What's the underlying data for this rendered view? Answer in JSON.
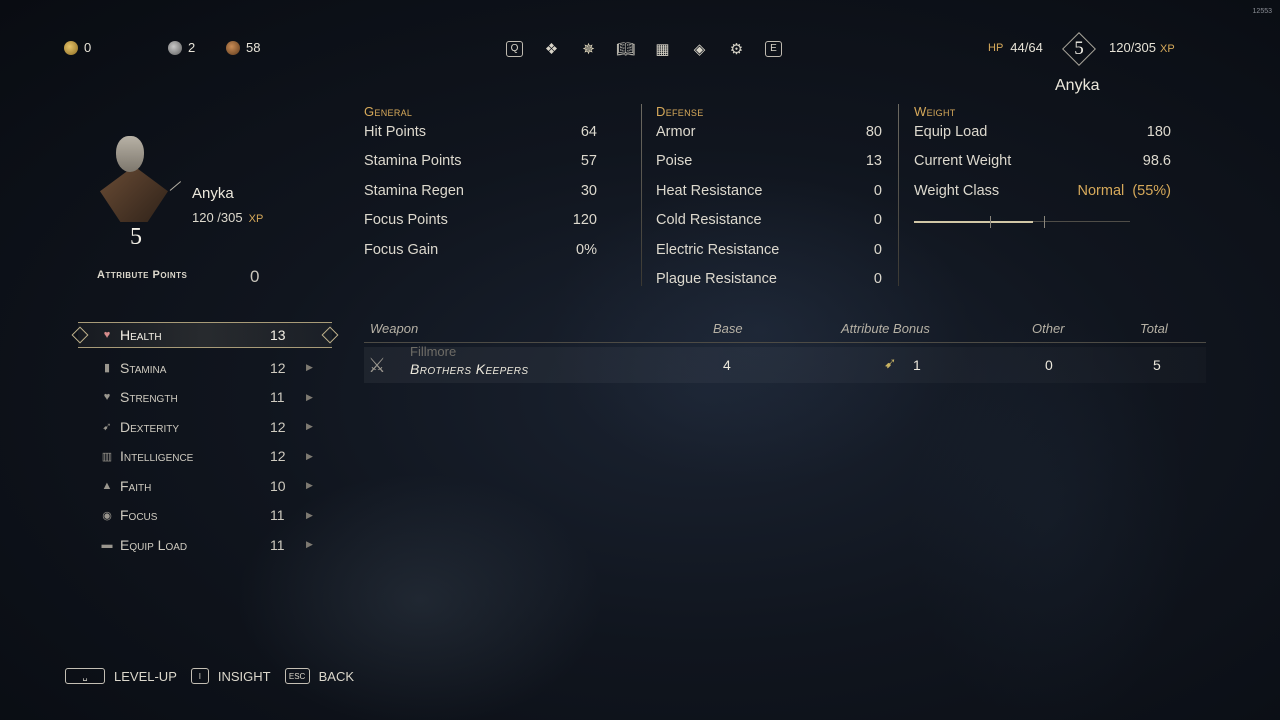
{
  "build": "12553",
  "currencies": [
    {
      "icon": "gold-coin-icon",
      "value": "0",
      "color": "#c9a646"
    },
    {
      "icon": "silver-coin-icon",
      "value": "2",
      "color": "#9a9a9a"
    },
    {
      "icon": "bronze-coin-icon",
      "value": "58",
      "color": "#a07040"
    }
  ],
  "nav": {
    "left_key": "Q",
    "right_key": "E",
    "icons": [
      "inventory-icon",
      "character-icon",
      "journal-icon",
      "map-icon",
      "insight-icon",
      "settings-icon"
    ],
    "active": "character-icon"
  },
  "status": {
    "hp_label": "HP",
    "hp": "44/64",
    "level": "5",
    "xp": "120/305",
    "xp_label": "XP",
    "name": "Anyka"
  },
  "character": {
    "name": "Anyka",
    "xp": "120 /305",
    "xp_label": "XP",
    "level": "5",
    "attribute_points_label": "Attribute Points",
    "attribute_points": "0"
  },
  "attributes": [
    {
      "name": "Health",
      "value": "13",
      "icon": "heart-icon"
    },
    {
      "name": "Stamina",
      "value": "12",
      "icon": "stamina-icon"
    },
    {
      "name": "Strength",
      "value": "11",
      "icon": "strength-icon"
    },
    {
      "name": "Dexterity",
      "value": "12",
      "icon": "dexterity-icon"
    },
    {
      "name": "Intelligence",
      "value": "12",
      "icon": "book-icon"
    },
    {
      "name": "Faith",
      "value": "10",
      "icon": "faith-icon"
    },
    {
      "name": "Focus",
      "value": "11",
      "icon": "eye-icon"
    },
    {
      "name": "Equip Load",
      "value": "11",
      "icon": "equip-load-icon"
    }
  ],
  "general": {
    "title": "General",
    "rows": [
      {
        "label": "Hit Points",
        "value": "64"
      },
      {
        "label": "Stamina Points",
        "value": "57"
      },
      {
        "label": "Stamina Regen",
        "value": "30"
      },
      {
        "label": "Focus Points",
        "value": "120"
      },
      {
        "label": "Focus Gain",
        "value": "0%"
      }
    ]
  },
  "defense": {
    "title": "Defense",
    "rows": [
      {
        "label": "Armor",
        "value": "80"
      },
      {
        "label": "Poise",
        "value": "13"
      },
      {
        "label": "Heat Resistance",
        "value": "0"
      },
      {
        "label": "Cold Resistance",
        "value": "0"
      },
      {
        "label": "Electric Resistance",
        "value": "0"
      },
      {
        "label": "Plague Resistance",
        "value": "0"
      }
    ]
  },
  "weight": {
    "title": "Weight",
    "rows": [
      {
        "label": "Equip Load",
        "value": "180"
      },
      {
        "label": "Current Weight",
        "value": "98.6"
      }
    ],
    "class_label": "Weight Class",
    "class_value": "Normal",
    "class_percent": "(55%)",
    "load_fraction": 0.55
  },
  "weapon_table": {
    "headers": {
      "weapon": "Weapon",
      "base": "Base",
      "attribute_bonus": "Attribute Bonus",
      "other": "Other",
      "total": "Total"
    },
    "row": {
      "subtitle": "Fillmore",
      "name": "Brothers Keepers",
      "base": "4",
      "bonus": "1",
      "other": "0",
      "total": "5"
    }
  },
  "hints": [
    {
      "key": "␣",
      "label": "LEVEL-UP"
    },
    {
      "key": "I",
      "label": "INSIGHT"
    },
    {
      "key": "ESC",
      "label": "BACK"
    }
  ]
}
